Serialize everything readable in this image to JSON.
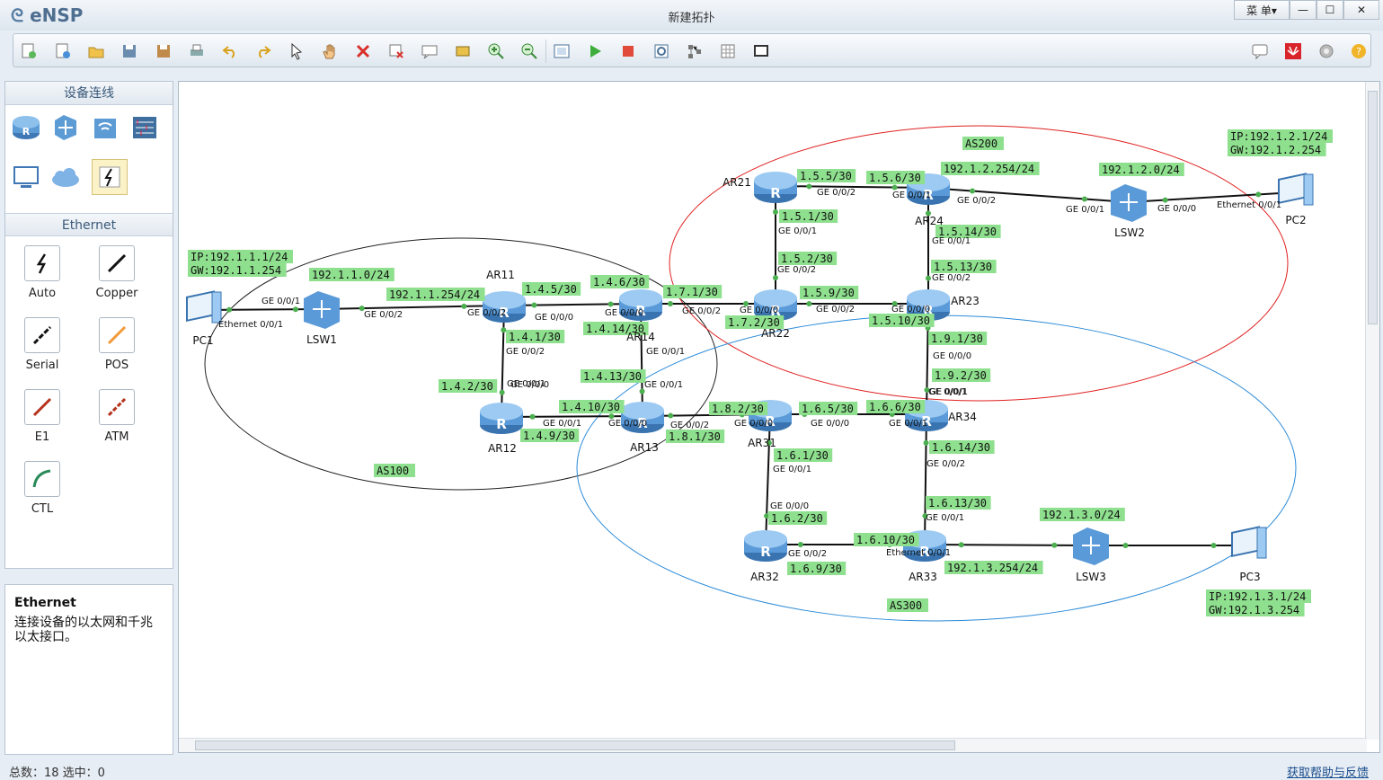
{
  "app": {
    "logo": "eNSP",
    "title": "新建拓扑",
    "menu_label": "菜 单▾"
  },
  "panel": {
    "devices_title": "设备连线",
    "cables_title": "Ethernet",
    "cables": [
      "Auto",
      "Copper",
      "Serial",
      "POS",
      "E1",
      "ATM",
      "CTL"
    ]
  },
  "description": {
    "title": "Ethernet",
    "text": "连接设备的以太网和千兆以太接口。"
  },
  "status": {
    "left": "总数：18 选中：0",
    "right": "获取帮助与反馈"
  },
  "topology": {
    "areas": [
      {
        "name": "AS100",
        "color": "#222222"
      },
      {
        "name": "AS200",
        "color": "#e02020"
      },
      {
        "name": "AS300",
        "color": "#2a8ad8"
      }
    ],
    "nodes": [
      {
        "id": "PC1",
        "type": "pc"
      },
      {
        "id": "LSW1",
        "type": "switch"
      },
      {
        "id": "AR11",
        "type": "router"
      },
      {
        "id": "AR12",
        "type": "router"
      },
      {
        "id": "AR13",
        "type": "router"
      },
      {
        "id": "AR14",
        "type": "router"
      },
      {
        "id": "AR21",
        "type": "router"
      },
      {
        "id": "AR22",
        "type": "router"
      },
      {
        "id": "AR23",
        "type": "router"
      },
      {
        "id": "AR24",
        "type": "router"
      },
      {
        "id": "LSW2",
        "type": "switch"
      },
      {
        "id": "PC2",
        "type": "pc"
      },
      {
        "id": "AR31",
        "type": "router"
      },
      {
        "id": "AR32",
        "type": "router"
      },
      {
        "id": "AR33",
        "type": "router"
      },
      {
        "id": "AR34",
        "type": "router"
      },
      {
        "id": "LSW3",
        "type": "switch"
      },
      {
        "id": "PC3",
        "type": "pc"
      }
    ],
    "labels": [
      "IP:192.1.1.1/24",
      "GW:192.1.1.254",
      "192.1.1.0/24",
      "192.1.1.254/24",
      "1.4.5/30",
      "1.4.6/30",
      "1.4.1/30",
      "1.4.2/30",
      "1.4.14/30",
      "1.4.13/30",
      "1.4.10/30",
      "1.4.9/30",
      "1.7.1/30",
      "1.7.2/30",
      "1.5.5/30",
      "1.5.6/30",
      "192.1.2.254/24",
      "192.1.2.0/24",
      "IP:192.1.2.1/24",
      "GW:192.1.2.254",
      "1.5.1/30",
      "1.5.2/30",
      "1.5.14/30",
      "1.5.13/30",
      "1.5.9/30",
      "1.5.10/30",
      "1.9.1/30",
      "1.9.2/30",
      "1.8.2/30",
      "1.8.1/30",
      "1.6.5/30",
      "1.6.6/30",
      "1.6.1/30",
      "1.6.2/30",
      "1.6.14/30",
      "1.6.13/30",
      "1.6.10/30",
      "1.6.9/30",
      "192.1.3.254/24",
      "192.1.3.0/24",
      "IP:192.1.3.1/24",
      "GW:192.1.3.254"
    ],
    "ports": [
      "GE 0/0/1",
      "Ethernet 0/0/1",
      "GE 0/0/2",
      "GE 0/0/2",
      "GE 0/0/0",
      "GE 0/0/0",
      "GE 0/0/2",
      "GE 0/0/1",
      "GE 0/0/0",
      "GE 0/0/1",
      "GE 0/0/1",
      "GE 0/0/1",
      "GE 0/0/0",
      "GE 0/0/2",
      "GE 0/0/2",
      "GE 0/0/0",
      "GE 0/0/0",
      "GE 0/0/2",
      "GE 0/0/1",
      "GE 0/0/2",
      "Ethernet 0/0/1",
      "GE 0/0/1",
      "GE 0/0/0",
      "GE 0/0/1",
      "GE 0/0/1",
      "GE 0/0/2",
      "GE 0/0/2",
      "GE 0/0/2",
      "GE 0/0/0",
      "GE 0/0/0",
      "GE 0/0/1",
      "GE 0/0/1",
      "GE 0/0/0",
      "GE 0/0/1",
      "GE 0/0/1",
      "GE 0/0/0",
      "GE 0/0/2",
      "GE 0/0/1",
      "GE 0/0/2",
      "Ethernet 0/0/1"
    ]
  }
}
